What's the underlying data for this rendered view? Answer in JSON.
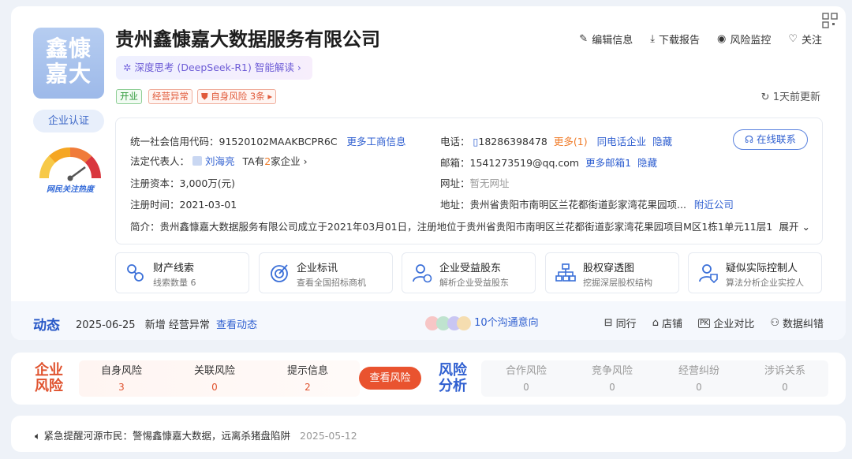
{
  "company": {
    "logo_text": "鑫慷嘉大",
    "name": "贵州鑫慷嘉大数据服务有限公司",
    "ai_insight": "深度思考 (DeepSeek-R1) 智能解读",
    "tags": [
      "开业",
      "经营异常",
      "自身风险 3条"
    ],
    "certification": "企业认证",
    "heat_label": "网民关注热度"
  },
  "actions": [
    "编辑信息",
    "下载报告",
    "风险监控",
    "关注"
  ],
  "update_text": "1天前更新",
  "info": {
    "credit_code_label": "统一社会信用代码：",
    "credit_code": "91520102MAAKBCPR6C",
    "more_business": "更多工商信息",
    "legal_rep_label": "法定代表人：",
    "legal_rep": "刘海亮",
    "legal_rep_companies_pre": "TA有",
    "legal_rep_companies_n": "2",
    "legal_rep_companies_post": "家企业",
    "capital_label": "注册资本：",
    "capital": "3,000万(元)",
    "reg_date_label": "注册时间：",
    "reg_date": "2021-03-01",
    "phone_label": "电话：",
    "phone": "18286398478",
    "phone_more": "更多(1)",
    "same_phone": "同电话企业",
    "hide1": "隐藏",
    "email_label": "邮箱：",
    "email": "1541273519@qq.com",
    "email_more": "更多邮箱1",
    "hide2": "隐藏",
    "website_label": "网址：",
    "website": "暂无网址",
    "address_label": "地址：",
    "address": "贵州省贵阳市南明区兰花都街道彭家湾花果园项...",
    "nearby": "附近公司",
    "online_contact": "在线联系",
    "intro_label": "简介：",
    "intro": "贵州鑫慷嘉大数据服务有限公司成立于2021年03月01日，注册地位于贵州省贵阳市南明区兰花都街道彭家湾花果园项目M区1栋1单元11层16...",
    "expand": "展开"
  },
  "features": [
    {
      "title": "财产线索",
      "sub": "线索数量 6",
      "icon": "property-clue-icon"
    },
    {
      "title": "企业标讯",
      "sub": "查看全国招标商机",
      "icon": "target-icon"
    },
    {
      "title": "企业受益股东",
      "sub": "解析企业受益股东",
      "icon": "shareholder-icon"
    },
    {
      "title": "股权穿透图",
      "sub": "挖掘深层股权结构",
      "icon": "equity-tree-icon"
    },
    {
      "title": "疑似实际控制人",
      "sub": "算法分析企业实控人",
      "icon": "controller-icon"
    }
  ],
  "dynamic": {
    "title": "动态",
    "date": "2025-06-25",
    "event": "新增 经营异常",
    "view": "查看动态",
    "comm": "10个沟通意向",
    "tools": [
      "同行",
      "店铺",
      "企业对比",
      "数据纠错"
    ]
  },
  "risk": {
    "company_risk_title": [
      "企业",
      "风险"
    ],
    "left_stats": [
      {
        "name": "自身风险",
        "value": "3"
      },
      {
        "name": "关联风险",
        "value": "0"
      },
      {
        "name": "提示信息",
        "value": "2"
      }
    ],
    "button": "查看风险",
    "analysis_title": [
      "风险",
      "分析"
    ],
    "right_stats": [
      {
        "name": "合作风险",
        "value": "0"
      },
      {
        "name": "竞争风险",
        "value": "0"
      },
      {
        "name": "经营纠纷",
        "value": "0"
      },
      {
        "name": "涉诉关系",
        "value": "0"
      }
    ]
  },
  "notice": {
    "text": "紧急提醒河源市民：警惕鑫慷嘉大数据，远离杀猪盘陷阱",
    "date": "2025-05-12"
  }
}
